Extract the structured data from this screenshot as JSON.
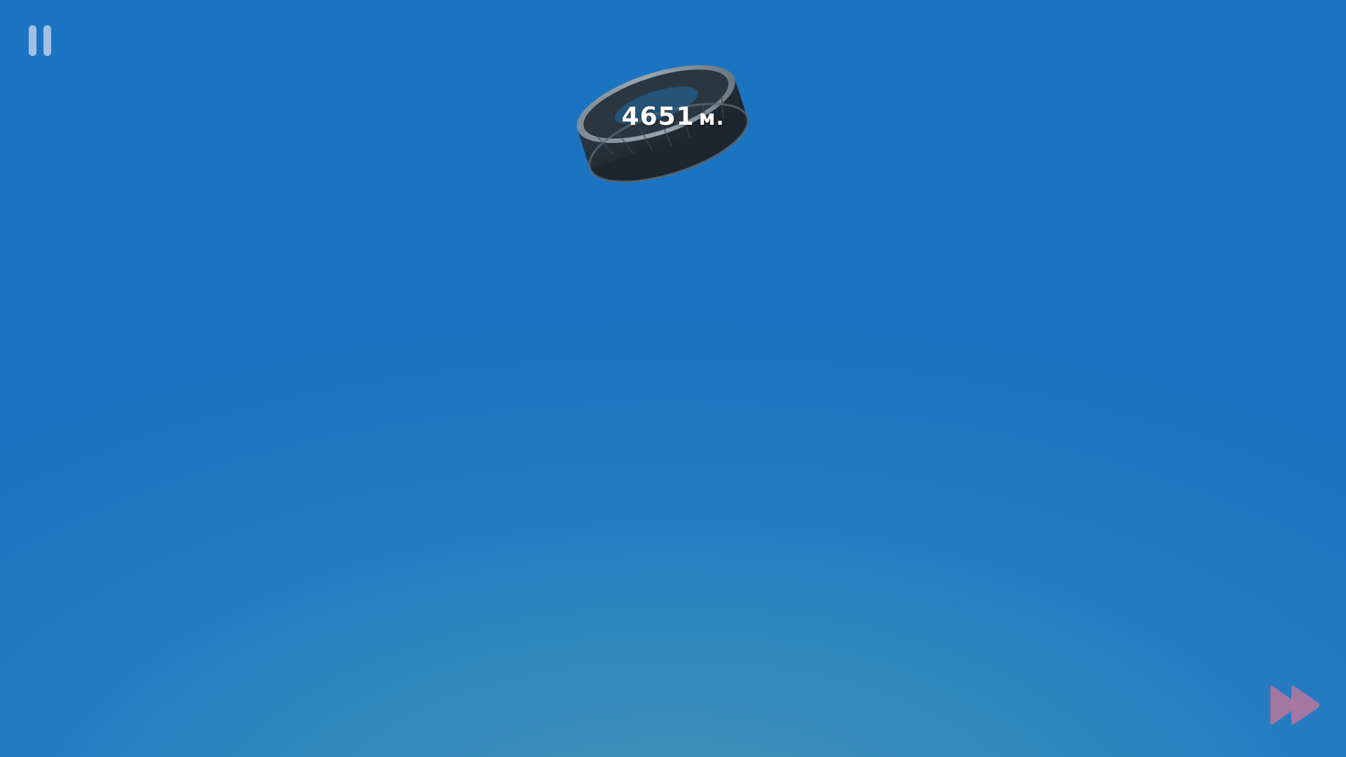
{
  "hud": {
    "pause_icon": "pause-icon",
    "fast_forward_icon": "fast-forward-icon",
    "fast_forward_color": "#b0789e",
    "pause_color": "#b8ceec"
  },
  "distance": {
    "value": "4651",
    "unit": "м."
  },
  "scene": {
    "sky_top_color": "#1b74c1",
    "sky_bottom_color": "#4796b4",
    "object": "tire"
  }
}
